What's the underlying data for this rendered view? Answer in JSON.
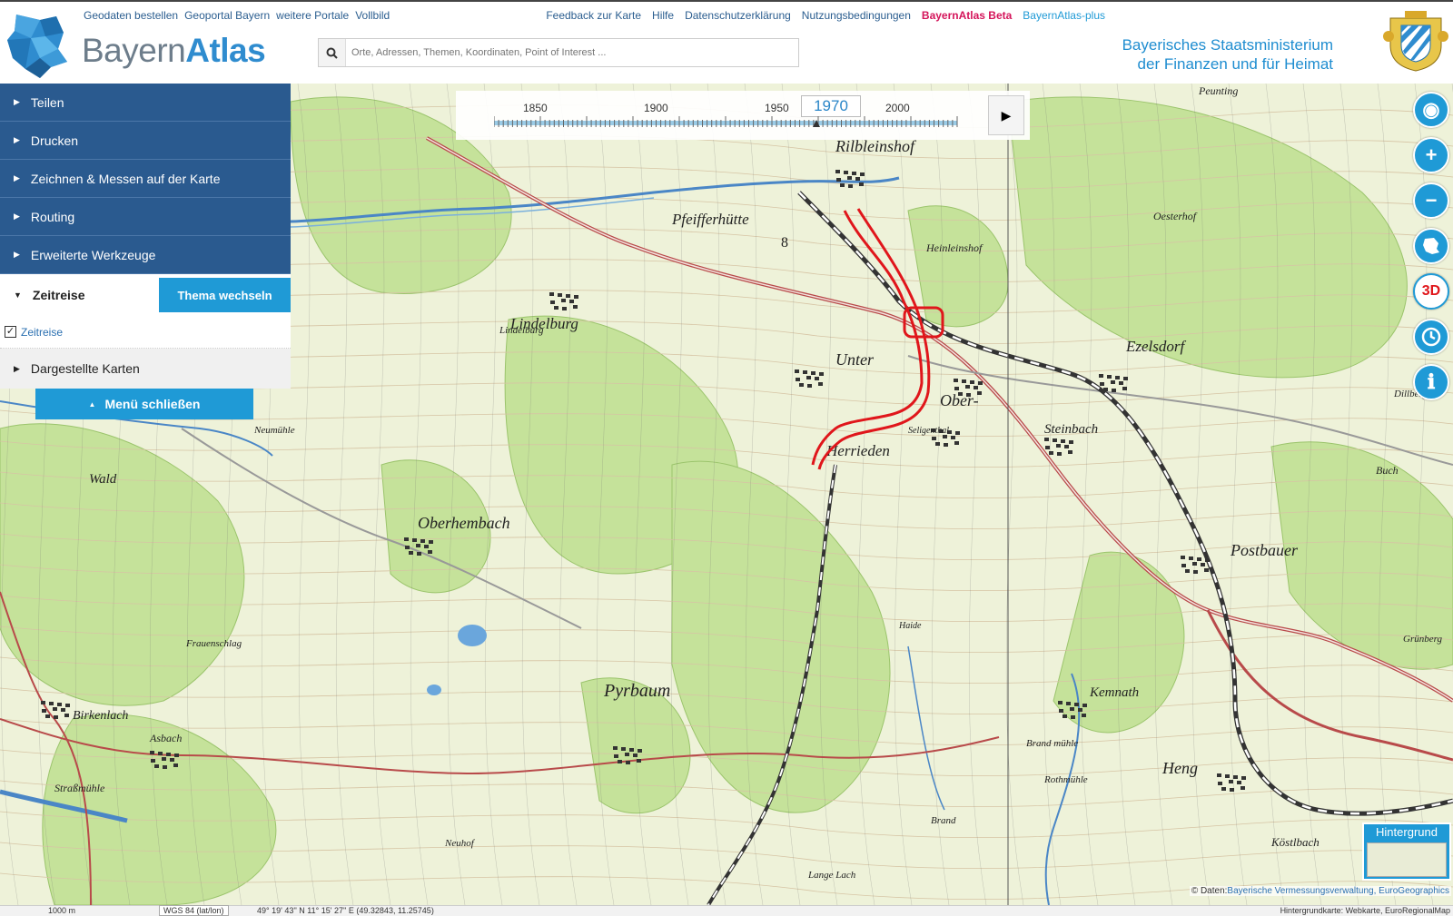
{
  "header": {
    "top_links": [
      "Geodaten bestellen",
      "Geoportal Bayern",
      "weitere Portale",
      "Vollbild"
    ],
    "right_links": [
      "Feedback zur Karte",
      "Hilfe",
      "Datenschutzerklärung",
      "Nutzungsbedingungen"
    ],
    "beta_link": "BayernAtlas Beta",
    "plus_link": "BayernAtlas-plus",
    "logo_prefix": "Bayern",
    "logo_suffix": "Atlas",
    "search_placeholder": "Orte, Adressen, Themen, Koordinaten, Point of Interest ...",
    "ministry_line1": "Bayerisches Staatsministerium",
    "ministry_line2": "der Finanzen und für Heimat"
  },
  "sidebar": {
    "items": [
      {
        "label": "Teilen"
      },
      {
        "label": "Drucken"
      },
      {
        "label": "Zeichnen & Messen auf der Karte"
      },
      {
        "label": "Routing"
      },
      {
        "label": "Erweiterte Werkzeuge"
      }
    ],
    "zeitreise_label": "Zeitreise",
    "thema_button": "Thema wechseln",
    "checkbox_label": "Zeitreise",
    "checkbox_checked": true,
    "dargestellte_label": "Dargestellte Karten",
    "close_menu_label": "Menü schließen"
  },
  "timeslider": {
    "year_labels": [
      "1850",
      "1900",
      "1950",
      "2000"
    ],
    "current_year": "1970"
  },
  "tools": {
    "icons": [
      "locate-icon",
      "zoom-in-icon",
      "zoom-out-icon",
      "bavaria-icon",
      "3d-icon",
      "time-icon",
      "info-icon"
    ],
    "threed_label": "3D"
  },
  "map": {
    "place_names": [
      "Rilbleinshof",
      "Pfeifferhütte",
      "Heinleinshof",
      "Lindelburg",
      "Unter",
      "Ober-",
      "Herrieden",
      "Ezelsdorf",
      "Steinbach",
      "Oberhembach",
      "Postbauer",
      "Pyrbaum",
      "Kemnath",
      "Heng",
      "Birkenlach",
      "Asbach",
      "Wald",
      "Frauenschlag",
      "Neumühle",
      "Brand",
      "Haide",
      "Seligenthal",
      "Dillberg",
      "Buch",
      "Grünberg",
      "Köstlbach",
      "Oesterhof",
      "Peunting",
      "Lange Lach",
      "Straßmühle",
      "Rothmühle",
      "Brand mühle",
      "Neuhof",
      "Lindelburg"
    ],
    "road_number": "8",
    "accent_red": "#e0161b"
  },
  "hintergrund_label": "Hintergrund",
  "attribution": {
    "prefix": "© Daten:",
    "sources": "Bayerische Vermessungsverwaltung, EuroGeographics"
  },
  "footer": {
    "scale": "1000 m",
    "crs": "WGS 84 (lat/lon)",
    "coordinates": "49° 19' 43'' N 11° 15' 27'' E (49.32843, 11.25745)",
    "background": "Hintergrundkarte: Webkarte, EuroRegionalMap"
  }
}
